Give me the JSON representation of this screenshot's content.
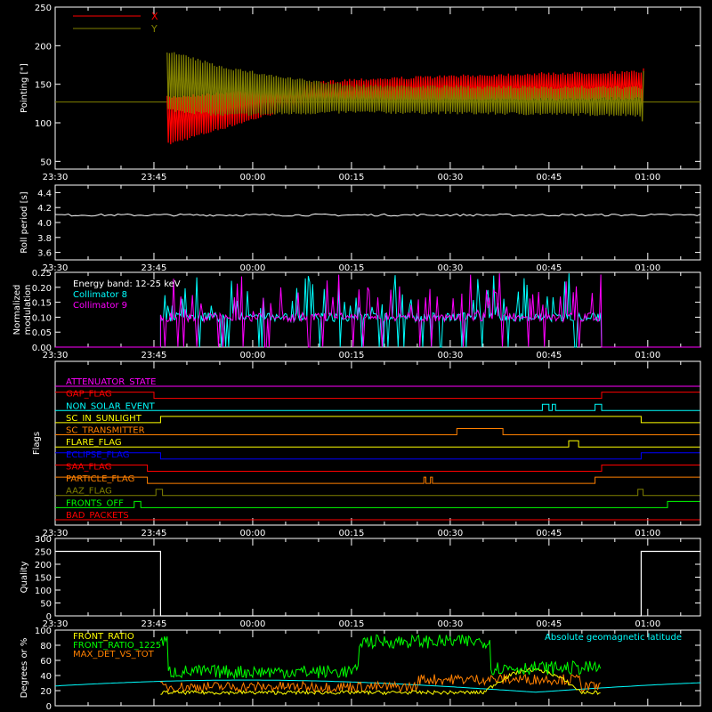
{
  "time_ticks": [
    "23:30",
    "23:45",
    "00:00",
    "00:15",
    "00:30",
    "00:45",
    "01:00"
  ],
  "colors": {
    "white": "#ffffff",
    "red": "#ff0000",
    "olive": "#808000",
    "cyan": "#00ffff",
    "magenta": "#ff00ff",
    "green": "#00ff00",
    "yellow": "#ffff00",
    "orange": "#ff8000",
    "blue": "#0000ff"
  },
  "chart_data": [
    {
      "type": "line",
      "ylabel": "Pointing [\"]",
      "ylim": [
        40,
        250
      ],
      "yticks": [
        "50",
        "100",
        "150",
        "200",
        "250"
      ],
      "legend_position": "top-left",
      "series": [
        {
          "name": "X",
          "color": "#ff0000",
          "note_shape": "oscillating band",
          "time": [
            "23:47",
            "23:55",
            "00:05",
            "00:15",
            "00:40",
            "00:59",
            "00:59.5"
          ],
          "upper": [
            135,
            140,
            150,
            158,
            165,
            168,
            175
          ],
          "lower": [
            70,
            90,
            115,
            125,
            128,
            130,
            95
          ]
        },
        {
          "name": "Y",
          "color": "#808000",
          "time": [
            "23:47",
            "23:55",
            "00:05",
            "00:15",
            "00:40",
            "00:59",
            "00:59.5"
          ],
          "upper": [
            195,
            175,
            160,
            150,
            148,
            148,
            175
          ],
          "lower": [
            115,
            108,
            110,
            112,
            110,
            108,
            90
          ]
        }
      ],
      "baseline": 127
    },
    {
      "type": "line",
      "ylabel": "Roll period [s]",
      "ylim": [
        3.5,
        4.5
      ],
      "yticks": [
        "3.6",
        "3.8",
        "4.0",
        "4.2",
        "4.4"
      ],
      "series": [
        {
          "name": "",
          "color": "#ffffff",
          "value": 4.1
        }
      ]
    },
    {
      "type": "line",
      "ylabel": "Normalized modulation",
      "ylim": [
        0,
        0.25
      ],
      "yticks": [
        "0.00",
        "0.05",
        "0.10",
        "0.15",
        "0.20",
        "0.25"
      ],
      "annotation": "Energy band: 12-25 keV",
      "series": [
        {
          "name": "Collimator 8",
          "color": "#00ffff"
        },
        {
          "name": "Collimator 9",
          "color": "#ff00ff"
        }
      ],
      "active_range": [
        "23:46",
        "00:53"
      ],
      "typical_value": 0.1
    },
    {
      "type": "line",
      "ylabel": "Flags",
      "series": [
        {
          "name": "ATTENUATOR_STATE",
          "color": "#ff00ff",
          "low_all": true
        },
        {
          "name": "GAP_FLAG",
          "color": "#ff0000",
          "high_until": "23:45",
          "high_from": "00:53"
        },
        {
          "name": "NON_SOLAR_EVENT",
          "color": "#00ffff",
          "pulses": [
            [
              "00:44",
              "00:45"
            ],
            [
              "00:45.5",
              "00:46"
            ],
            [
              "00:52",
              "00:53"
            ]
          ]
        },
        {
          "name": "SC_IN_SUNLIGHT",
          "color": "#ffff00",
          "high_range": [
            "23:46",
            "00:59"
          ]
        },
        {
          "name": "SC_TRANSMITTER",
          "color": "#ff8000",
          "high_range": [
            "00:31",
            "00:38"
          ]
        },
        {
          "name": "FLARE_FLAG",
          "color": "#ffff00",
          "high_range": [
            "00:48",
            "00:49.5"
          ]
        },
        {
          "name": "ECLIPSE_FLAG",
          "color": "#0000ff",
          "high_until": "23:46",
          "high_from": "00:59"
        },
        {
          "name": "SAA_FLAG",
          "color": "#ff0000",
          "high_until": "23:44",
          "high_from": "00:53"
        },
        {
          "name": "PARTICLE_FLAG",
          "color": "#ff8000",
          "high_until": "23:44",
          "high_from": "00:52",
          "pulses": [
            [
              "00:26",
              "00:26.3"
            ],
            [
              "00:27",
              "00:27.3"
            ]
          ]
        },
        {
          "name": "AAZ_FLAG",
          "color": "#808000",
          "pulses": [
            [
              "23:45.3",
              "23:46.3"
            ],
            [
              "00:58.5",
              "00:59.3"
            ]
          ]
        },
        {
          "name": "FRONTS_OFF",
          "color": "#00ff00",
          "pulses": [
            [
              "23:42",
              "23:43"
            ]
          ],
          "high_from": "01:03"
        },
        {
          "name": "BAD_PACKETS",
          "color": "#ff0000",
          "low_all": true
        }
      ]
    },
    {
      "type": "line",
      "ylabel": "Quality",
      "ylim": [
        0,
        300
      ],
      "yticks": [
        "0",
        "50",
        "100",
        "150",
        "200",
        "250",
        "300"
      ],
      "series": [
        {
          "name": "",
          "color": "#ffffff",
          "high_value": 250,
          "high_until": "23:46",
          "high_from": "00:59"
        }
      ]
    },
    {
      "type": "line",
      "ylabel": "Degrees or %",
      "ylim": [
        0,
        100
      ],
      "yticks": [
        "0",
        "20",
        "40",
        "60",
        "80",
        "100"
      ],
      "series": [
        {
          "name": "FRONT_RATIO",
          "color": "#ffff00"
        },
        {
          "name": "FRONT_RATIO_1225",
          "color": "#00ff00"
        },
        {
          "name": "MAX_DET_VS_TOT",
          "color": "#ff8000"
        },
        {
          "name": "Absolute geomagnetic latitude",
          "color": "#00ffff"
        }
      ],
      "active_range": [
        "23:46",
        "00:53"
      ]
    }
  ]
}
